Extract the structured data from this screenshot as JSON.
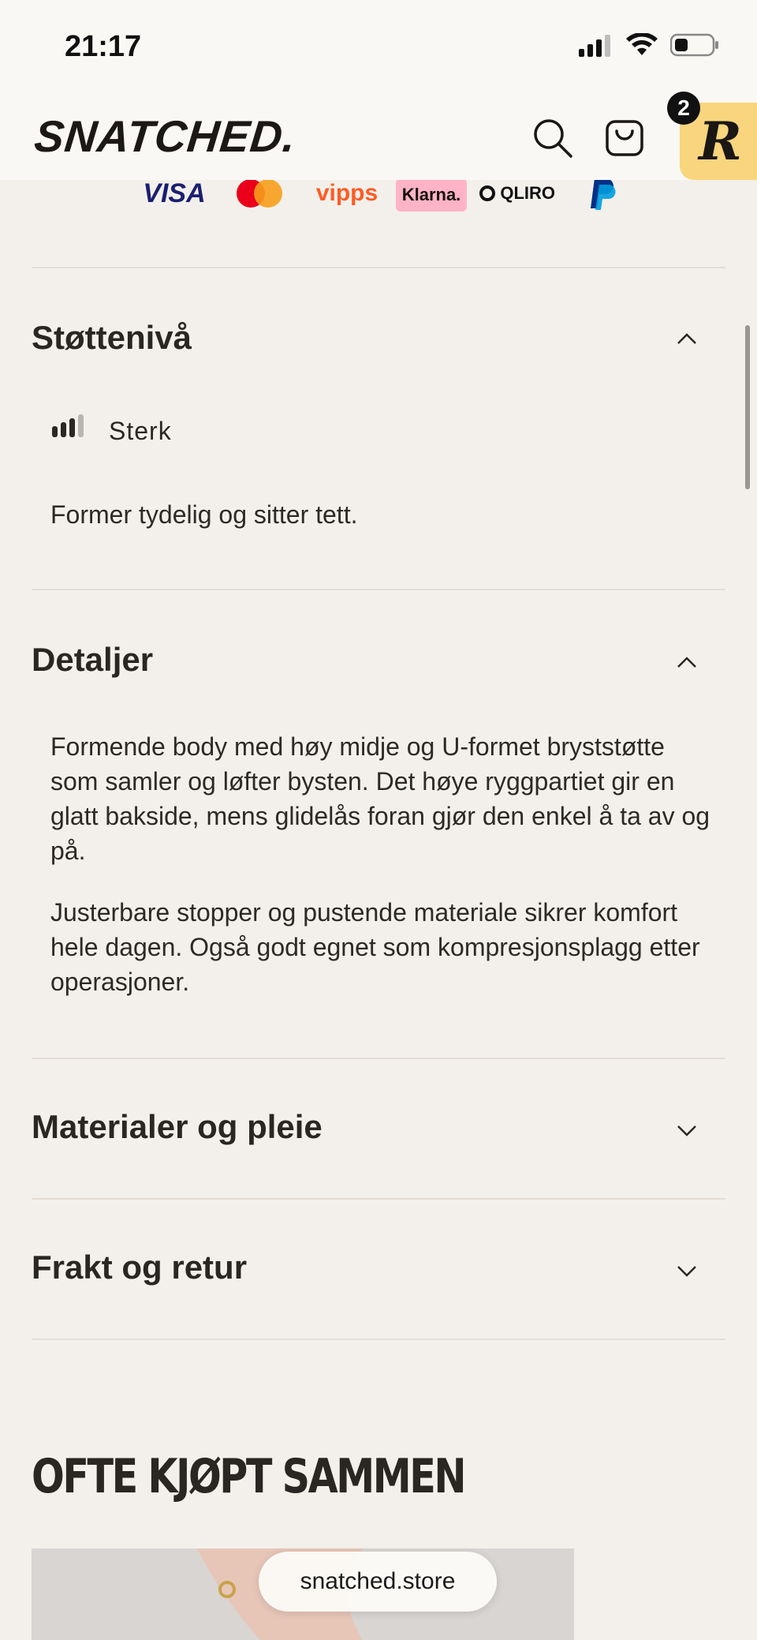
{
  "status_bar": {
    "time": "21:17"
  },
  "header": {
    "logo": "SNATCHED.",
    "cart_count": "2",
    "badge_letter": "R"
  },
  "payments": {
    "visa": "VISA",
    "vipps": "vipps",
    "klarna": "Klarna.",
    "qliro": "QLIRO"
  },
  "support": {
    "title": "Støttenivå",
    "level_label": "Sterk",
    "level_value": 3,
    "level_max": 4,
    "description": "Former tydelig og sitter tett."
  },
  "details": {
    "title": "Detaljer",
    "paragraph1": "Formende body med høy midje og U-formet bryststøtte som samler og løfter bysten. Det høye ryggpartiet gir en glatt bakside, mens glidelås foran gjør den enkel å ta av og på.",
    "paragraph2": "Justerbare stopper og pustende materiale sikrer komfort hele dagen. Også godt egnet som kompresjonsplagg etter operasjoner."
  },
  "materials": {
    "title": "Materialer og pleie"
  },
  "shipping": {
    "title": "Frakt og retur"
  },
  "related": {
    "heading": "OFTE KJØPT SAMMEN"
  },
  "browser": {
    "url": "snatched.store"
  }
}
